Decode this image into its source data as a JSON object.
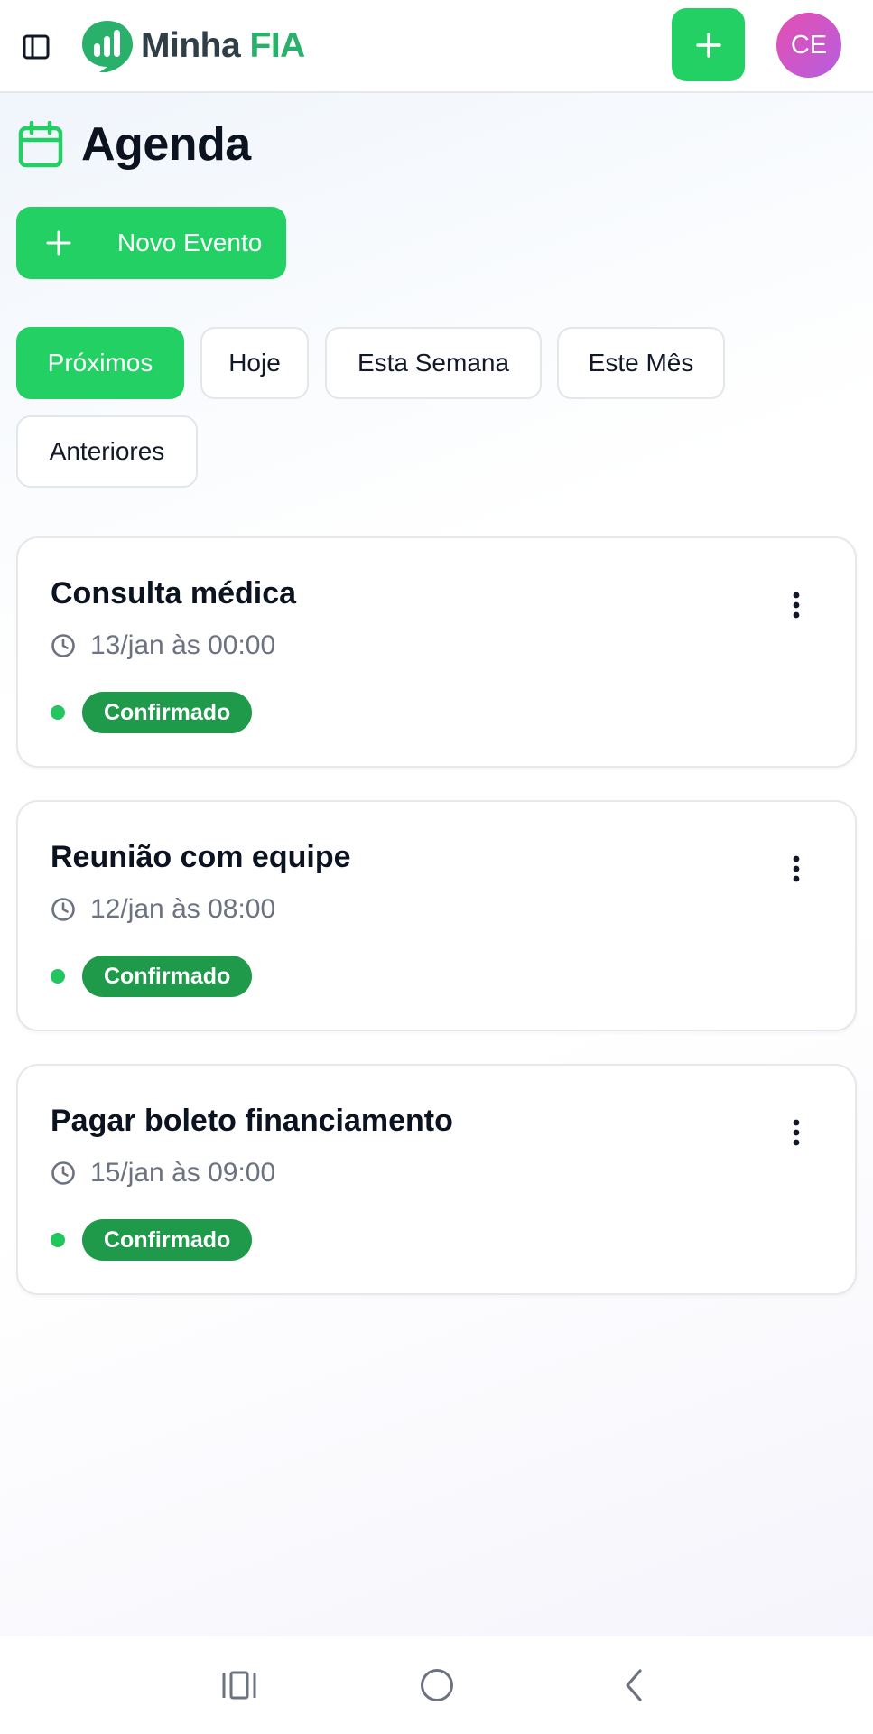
{
  "app": {
    "logo_text_part1": "Minha",
    "logo_text_part2": "FIA",
    "avatar_initials": "CE"
  },
  "page": {
    "title": "Agenda",
    "new_event_label": "Novo Evento"
  },
  "filters": [
    {
      "label": "Próximos",
      "active": true
    },
    {
      "label": "Hoje",
      "active": false
    },
    {
      "label": "Esta Semana",
      "active": false
    },
    {
      "label": "Este Mês",
      "active": false
    },
    {
      "label": "Anteriores",
      "active": false
    }
  ],
  "events": [
    {
      "title": "Consulta médica",
      "datetime": "13/jan às 00:00",
      "status": "Confirmado"
    },
    {
      "title": "Reunião com equipe",
      "datetime": "12/jan às 08:00",
      "status": "Confirmado"
    },
    {
      "title": "Pagar boleto financiamento",
      "datetime": "15/jan às 09:00",
      "status": "Confirmado"
    }
  ],
  "colors": {
    "accent": "#22d063",
    "status_badge": "#1f9a4a",
    "status_dot": "#22c55e",
    "logo_green": "#29b06a",
    "avatar_start": "#e54fb0",
    "avatar_end": "#b65ee0"
  },
  "icons": {
    "sidebar_toggle": "sidebar-icon",
    "logo": "bar-chart-bubble-icon",
    "top_add": "plus-icon",
    "page_title": "calendar-icon",
    "event_time": "clock-icon",
    "event_menu": "more-vertical-icon",
    "nav_recent": "recent-apps-icon",
    "nav_home": "home-circle-icon",
    "nav_back": "back-chevron-icon"
  }
}
